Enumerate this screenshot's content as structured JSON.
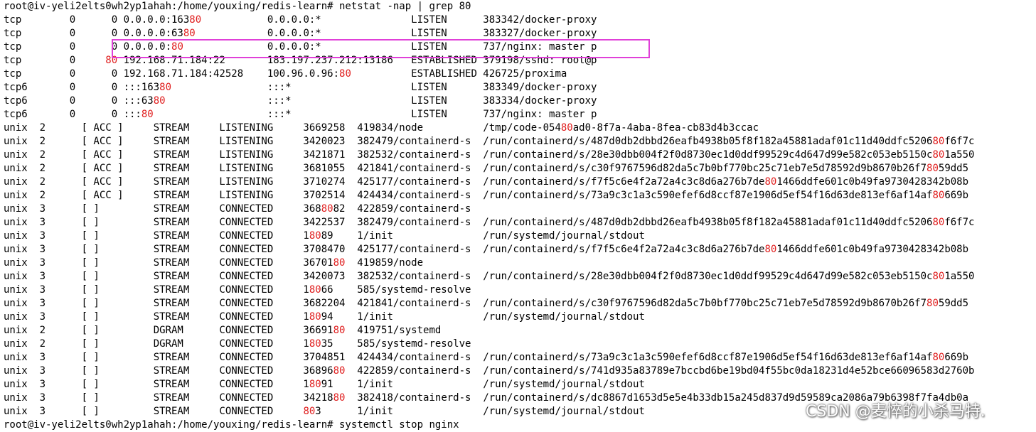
{
  "colors": {
    "background": "#ffffff",
    "text": "#000000",
    "match_highlight": "#e02020",
    "annotation_box": "#e040d8"
  },
  "highlight_term": "80",
  "terminal": {
    "lines": [
      "root@iv-yeli2elts0wh2yp1ahah:/home/youxing/redis-learn# netstat -nap | grep 80",
      "tcp        0      0 0.0.0.0:16380           0.0.0.0:*               LISTEN      383342/docker-proxy",
      "tcp        0      0 0.0.0.0:6380            0.0.0.0:*               LISTEN      383327/docker-proxy",
      "tcp        0      0 0.0.0.0:80              0.0.0.0:*               LISTEN      737/nginx: master p",
      "tcp        0     80 192.168.71.184:22       183.197.237.212:13186   ESTABLISHED 379198/sshd: root@p",
      "tcp        0      0 192.168.71.184:42528    100.96.0.96:80          ESTABLISHED 426725/proxima",
      "tcp6       0      0 :::16380                :::*                    LISTEN      383349/docker-proxy",
      "tcp6       0      0 :::6380                 :::*                    LISTEN      383334/docker-proxy",
      "tcp6       0      0 :::80                   :::*                    LISTEN      737/nginx: master p",
      "unix  2      [ ACC ]     STREAM     LISTENING     3669258  419834/node          /tmp/code-05480ad0-8f7a-4aba-8fea-cb83d4b3ccac",
      "unix  2      [ ACC ]     STREAM     LISTENING     3420023  382479/containerd-s  /run/containerd/s/487d0db2dbbd26eafb4938b05f8f182a45881adaf01c11d40ddfc520680f6f7c",
      "unix  2      [ ACC ]     STREAM     LISTENING     3421871  382532/containerd-s  /run/containerd/s/28e30dbb004f2f0d8730ec1d0ddf99529c4d647d99e582c053eb5150c801a550",
      "unix  2      [ ACC ]     STREAM     LISTENING     3681055  421841/containerd-s  /run/containerd/s/c30f9767596d82da5c7b0bf770bc25c71eb7e5d78592d9b8670b26f78059dd5",
      "unix  2      [ ACC ]     STREAM     LISTENING     3710274  425177/containerd-s  /run/containerd/s/f7f5c6e4f2a72a4c3c8d6a276b7de801466ddfe601c0b49fa9730428342b08b",
      "unix  2      [ ACC ]     STREAM     LISTENING     3702514  424434/containerd-s  /run/containerd/s/73a9c3c1a3c590efef6d8ccf87e1906d5ef54f16d63de813ef6af14af80669b",
      "unix  3      [ ]         STREAM     CONNECTED     3688082  422859/containerd-s",
      "unix  3      [ ]         STREAM     CONNECTED     3422537  382479/containerd-s  /run/containerd/s/487d0db2dbbd26eafb4938b05f8f182a45881adaf01c11d40ddfc520680f6f7c",
      "unix  3      [ ]         STREAM     CONNECTED     18089    1/init               /run/systemd/journal/stdout",
      "unix  3      [ ]         STREAM     CONNECTED     3708470  425177/containerd-s  /run/containerd/s/f7f5c6e4f2a72a4c3c8d6a276b7de801466ddfe601c0b49fa9730428342b08b",
      "unix  3      [ ]         STREAM     CONNECTED     3670180  419859/node",
      "unix  3      [ ]         STREAM     CONNECTED     3420073  382532/containerd-s  /run/containerd/s/28e30dbb004f2f0d8730ec1d0ddf99529c4d647d99e582c053eb5150c801a550",
      "unix  3      [ ]         STREAM     CONNECTED     18066    585/systemd-resolve",
      "unix  3      [ ]         STREAM     CONNECTED     3682204  421841/containerd-s  /run/containerd/s/c30f9767596d82da5c7b0bf770bc25c71eb7e5d78592d9b8670b26f78059dd5",
      "unix  3      [ ]         STREAM     CONNECTED     18094    1/init               /run/systemd/journal/stdout",
      "unix  2      [ ]         DGRAM      CONNECTED     3669180  419751/systemd",
      "unix  2      [ ]         DGRAM      CONNECTED     18035    585/systemd-resolve",
      "unix  3      [ ]         STREAM     CONNECTED     3704851  424434/containerd-s  /run/containerd/s/73a9c3c1a3c590efef6d8ccf87e1906d5ef54f16d63de813ef6af14af80669b",
      "unix  3      [ ]         STREAM     CONNECTED     3689680  422859/containerd-s  /run/containerd/s/741d935a83789e7bccbd6be19bd04f55bc0da18231d4e52bce66096583d2760b",
      "unix  3      [ ]         STREAM     CONNECTED     18091    1/init               /run/systemd/journal/stdout",
      "unix  3      [ ]         STREAM     CONNECTED     3421880  382418/containerd-s  /run/containerd/s/dc8867d1653d5e5e4b33db15a245d837d9d59589ca2086a79b6398f7fa4db0a",
      "unix  3      [ ]         STREAM     CONNECTED     803      1/init               /run/systemd/journal/stdout",
      "root@iv-yeli2elts0wh2yp1ahah:/home/youxing/redis-learn# systemctl stop nginx"
    ],
    "highlighted_line_index": 3
  },
  "watermark": "CSDN @麦悴的小杀马特."
}
